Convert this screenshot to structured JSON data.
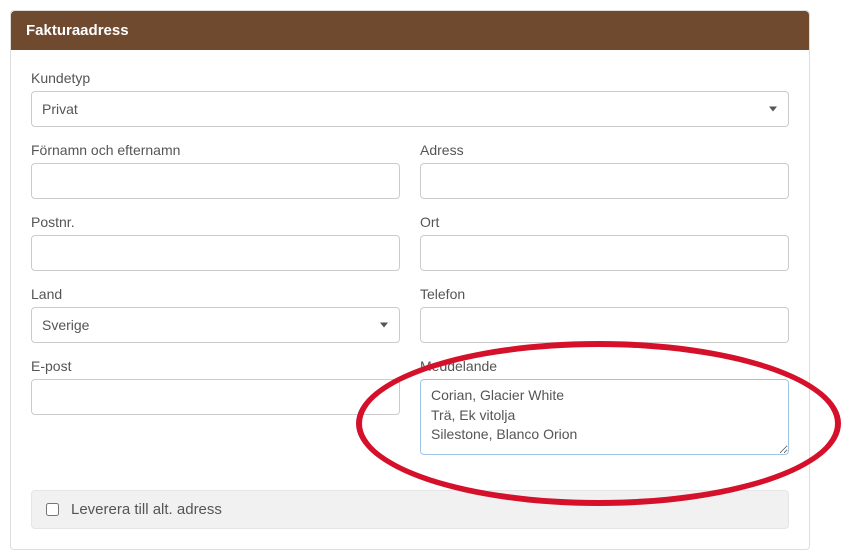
{
  "panel": {
    "title": "Fakturaadress"
  },
  "labels": {
    "kundetyp": "Kundetyp",
    "fornamn": "Förnamn och efternamn",
    "adress": "Adress",
    "postnr": "Postnr.",
    "ort": "Ort",
    "land": "Land",
    "telefon": "Telefon",
    "epost": "E-post",
    "meddelande": "Meddelande",
    "leverera": "Leverera till alt. adress"
  },
  "values": {
    "kundetyp": "Privat",
    "fornamn": "",
    "adress": "",
    "postnr": "",
    "ort": "",
    "land": "Sverige",
    "telefon": "",
    "epost": "",
    "meddelande": "Corian, Glacier White\nTrä, Ek vitolja\nSilestone, Blanco Orion"
  }
}
